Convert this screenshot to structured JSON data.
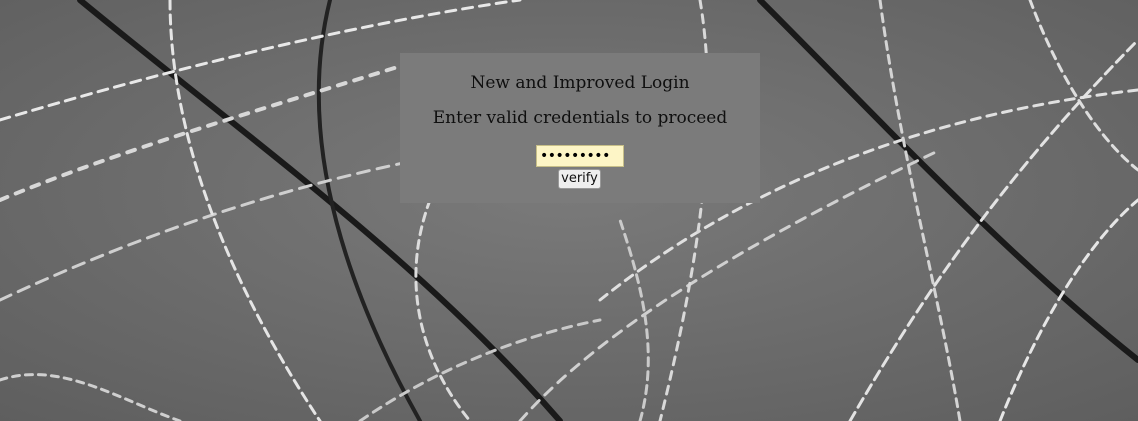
{
  "page": {
    "title": "New and Improved Login",
    "subtitle": "Enter valid credentials to proceed"
  },
  "form": {
    "password_value": "secret123",
    "verify_label": "verify"
  },
  "colors": {
    "page_background": "#6d6d6d",
    "panel_background": "#7b7b7b",
    "input_background": "#fdf5c6"
  },
  "icons": {
    "background": "barbed-wire-background"
  }
}
